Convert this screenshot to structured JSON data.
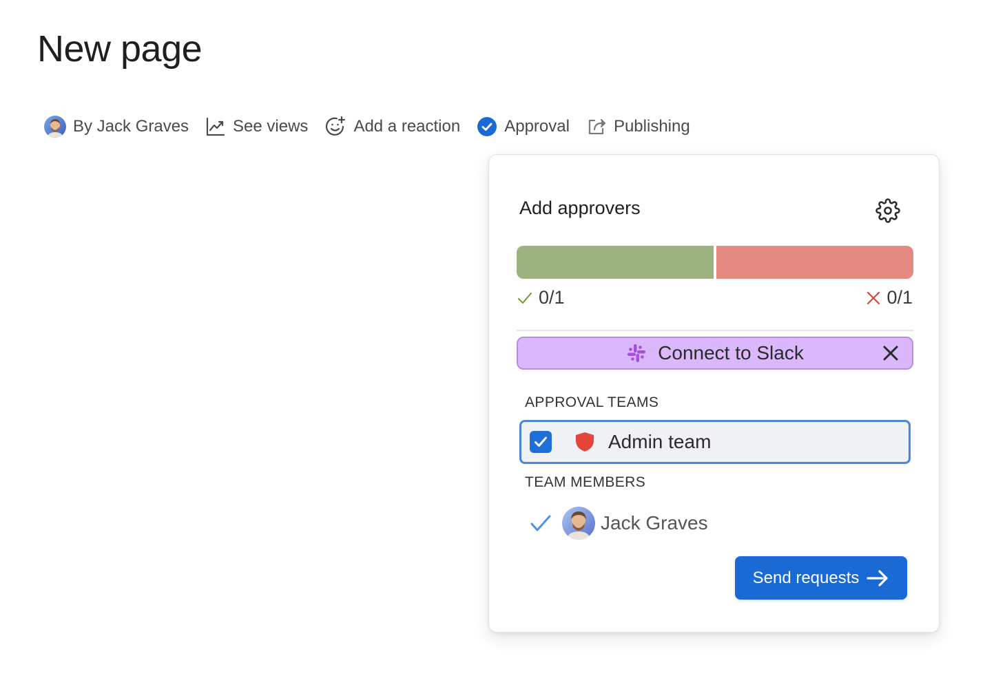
{
  "page": {
    "title": "New page"
  },
  "byline": {
    "author_label": "By Jack Graves",
    "see_views_label": "See views",
    "add_reaction_label": "Add a reaction",
    "approval_label": "Approval",
    "publishing_label": "Publishing"
  },
  "approvals_panel": {
    "header": "Add approvers",
    "progress": {
      "approved_fraction": 0.5,
      "approved_count": "0/1",
      "rejected_count": "0/1"
    },
    "slack_banner": {
      "label": "Connect to Slack"
    },
    "approval_teams_heading": "APPROVAL TEAMS",
    "teams": [
      {
        "name": "Admin team",
        "checked": true
      }
    ],
    "team_members_heading": "TEAM MEMBERS",
    "members": [
      {
        "name": "Jack Graves",
        "checked": true
      }
    ],
    "send_button_label": "Send requests"
  },
  "colors": {
    "approved_bar": "#9db37f",
    "rejected_bar": "#e38b83",
    "slack_banner_bg": "#dab8fb",
    "slack_banner_border": "#b98be6",
    "primary_blue": "#1a6ad6",
    "team_row_border": "#4a86d4",
    "shield_red": "#e5443a"
  },
  "icons": {
    "author_avatar": "avatar-icon",
    "see_views": "chart-line-icon",
    "add_reaction": "smiley-add-icon",
    "approval": "check-circle-icon",
    "publishing": "share-icon",
    "settings": "gear-icon",
    "approved": "check-icon",
    "rejected": "x-icon",
    "slack": "slack-icon",
    "close": "close-icon",
    "team": "shield-icon",
    "send": "arrow-right-icon"
  }
}
